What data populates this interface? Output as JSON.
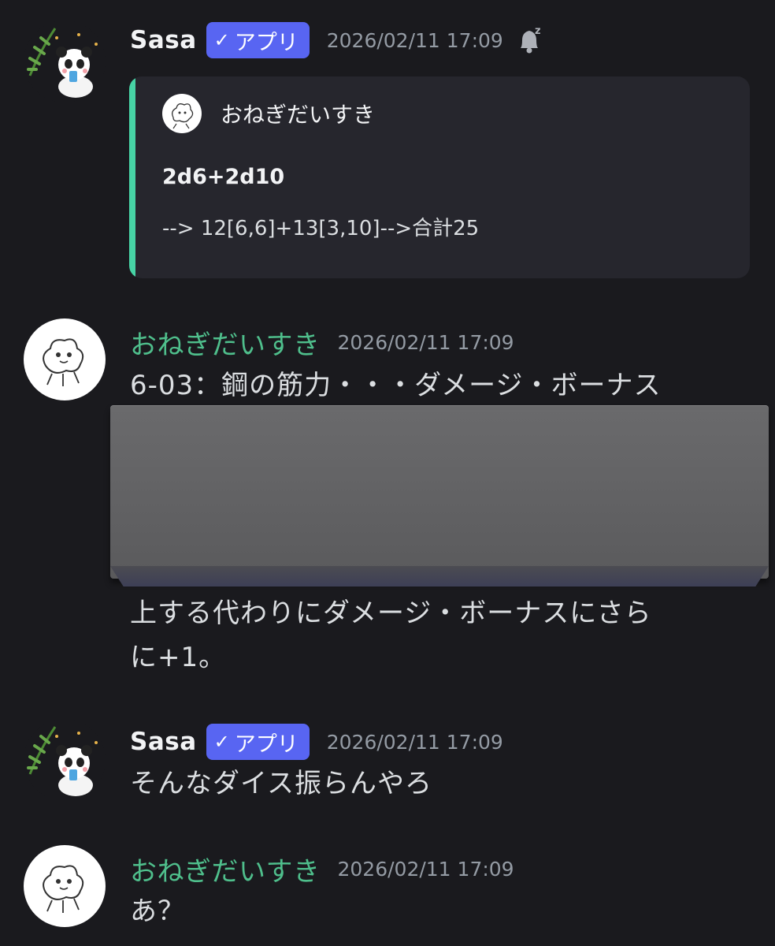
{
  "messages": [
    {
      "user": "Sasa",
      "badge": "アプリ",
      "badge_check": "✓",
      "timestamp": "2026/02/11 17:09",
      "embed": {
        "author": "おねぎだいすき",
        "line1": "2d6+2d10",
        "line2": "--> 12[6,6]+13[3,10]-->合計25",
        "accent_color": "#47d3a5"
      }
    },
    {
      "user": "おねぎだいすき",
      "timestamp": "2026/02/11 17:09",
      "lines": [
        "6-03：鋼の筋力・・・ダメージ・ボーナス",
        "上する代わりにダメージ・ボーナスにさら",
        "に+1。"
      ]
    },
    {
      "user": "Sasa",
      "badge": "アプリ",
      "badge_check": "✓",
      "timestamp": "2026/02/11 17:09",
      "lines": [
        "そんなダイス振らんやろ"
      ]
    },
    {
      "user": "おねぎだいすき",
      "timestamp": "2026/02/11 17:09",
      "lines": [
        "あ？"
      ]
    }
  ],
  "colors": {
    "background": "#1a1a1e",
    "badge": "#5865f2",
    "green_name": "#4fbf8c",
    "timestamp": "#949ba4"
  },
  "icons": [
    "panda-avatar-icon",
    "scribble-avatar-icon",
    "sleeping-bell-icon",
    "check-icon"
  ]
}
